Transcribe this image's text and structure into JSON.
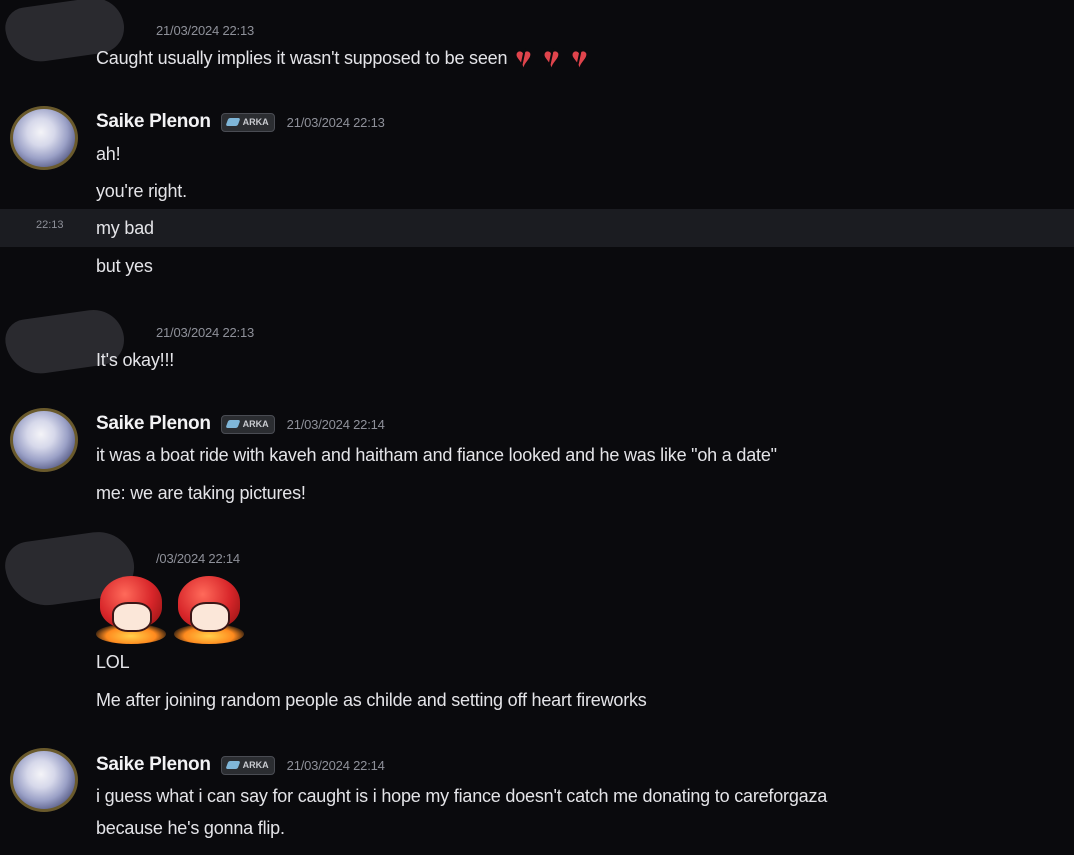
{
  "messages": {
    "group1": {
      "timestamp": "21/03/2024 22:13",
      "lines": [
        "Caught usually implies it wasn't supposed to be seen"
      ],
      "emoji": [
        "broken-heart",
        "broken-heart",
        "broken-heart"
      ]
    },
    "group2": {
      "username": "Saike Plenon",
      "tag": "ARKA",
      "timestamp": "21/03/2024 22:13",
      "lines": [
        "ah!",
        "you're right.",
        "my bad",
        "but yes"
      ],
      "hover_time": "22:13"
    },
    "group3": {
      "timestamp": "21/03/2024 22:13",
      "lines": [
        "It's okay!!!"
      ]
    },
    "group4": {
      "username": "Saike Plenon",
      "tag": "ARKA",
      "timestamp": "21/03/2024 22:14",
      "lines": [
        "it was a boat ride with kaveh and haitham and fiance looked and he was like \"oh a date\"",
        "me: we are taking pictures!"
      ]
    },
    "group5": {
      "timestamp": "/03/2024 22:14",
      "stickers": [
        "red-haired-chibi-sticker",
        "red-haired-chibi-sticker"
      ],
      "lines": [
        "LOL",
        "Me after joining random people as childe and setting off heart fireworks"
      ]
    },
    "group6": {
      "username": "Saike Plenon",
      "tag": "ARKA",
      "timestamp": "21/03/2024 22:14",
      "lines": [
        "i guess what i can say for caught is i hope my fiance doesn't catch me donating to careforgaza",
        "because he's gonna flip."
      ]
    }
  },
  "colors": {
    "background": "#0a0a0d",
    "hover_row": "#1b1c21",
    "heart": "#e0444c"
  }
}
